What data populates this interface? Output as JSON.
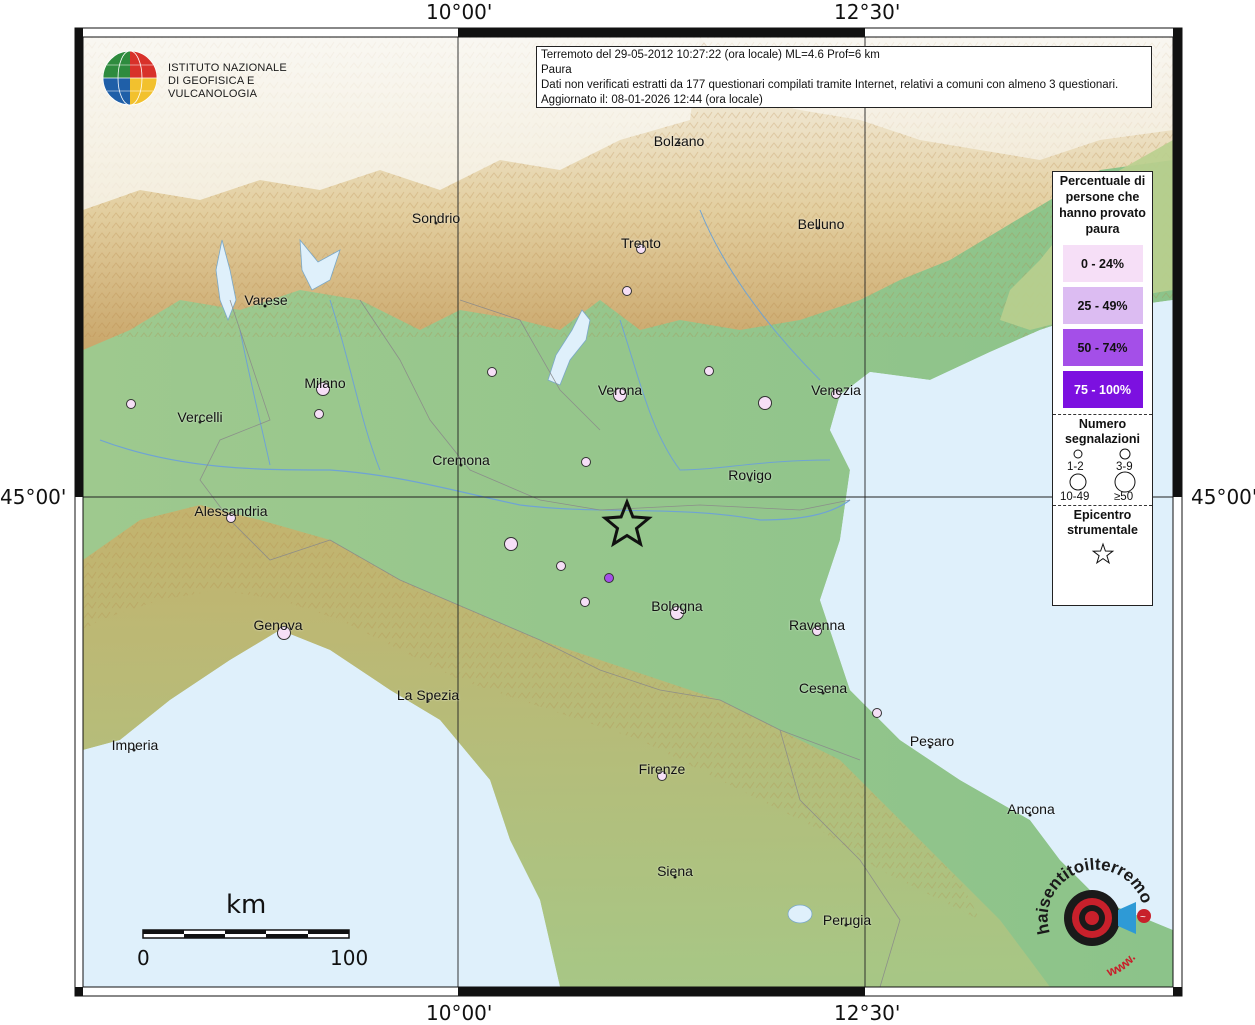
{
  "title_box": {
    "line1": "Terremoto del 29-05-2012 10:27:22 (ora locale) ML=4.6 Prof=6 km",
    "line2": "Paura",
    "line3": "Dati non verificati estratti da 177 questionari compilati tramite Internet, relativi a comuni con almeno 3 questionari.",
    "line4": "Aggiornato il: 08-01-2026 12:44 (ora locale)"
  },
  "logo": {
    "line1": "ISTITUTO NAZIONALE",
    "line2": "DI GEOFISICA E VULCANOLOGIA"
  },
  "axes": {
    "lon_top_1": "10°00'",
    "lon_top_2": "12°30'",
    "lon_bottom_1": "10°00'",
    "lon_bottom_2": "12°30'",
    "lat_left": "45°00'",
    "lat_right": "45°00'"
  },
  "cities": {
    "bolzano": "Bolzano",
    "sondrio": "Sondrio",
    "belluno": "Belluno",
    "trento": "Trento",
    "varese": "Varese",
    "milano": "Milano",
    "verona": "Verona",
    "venezia": "Venezia",
    "vercelli": "Vercelli",
    "cremona": "Cremona",
    "rovigo": "Rovigo",
    "alessandria": "Alessandria",
    "bologna": "Bologna",
    "genova": "Genova",
    "ravenna": "Ravenna",
    "cesena": "Cesena",
    "la_spezia": "La Spezia",
    "pesaro": "Pesaro",
    "imperia": "Imperia",
    "firenze": "Firenze",
    "ancona": "Ancona",
    "siena": "Siena",
    "perugia": "Perugia"
  },
  "legend": {
    "title": "Percentuale di persone che hanno provato paura",
    "bins": [
      {
        "label": "0 - 24%",
        "color": "#f6dff7"
      },
      {
        "label": "25 - 49%",
        "color": "#dcbcf2"
      },
      {
        "label": "50 - 74%",
        "color": "#a44fe8"
      },
      {
        "label": "75 - 100%",
        "color": "#7c10e0"
      }
    ],
    "count_title": "Numero segnalazioni",
    "count_labels": [
      "1-2",
      "3-9",
      "10-49",
      "≥50"
    ],
    "epicenter_title": "Epicentro strumentale"
  },
  "scale": {
    "unit": "km",
    "min": "0",
    "max": "100"
  },
  "branding": {
    "sentito": "haisentitoilterremoto.it",
    "www": "www."
  },
  "observations": [
    {
      "place": "Trento area",
      "bin": 0,
      "count": "1-2"
    },
    {
      "place": "Trento south",
      "bin": 0,
      "count": "1-2"
    },
    {
      "place": "Milano",
      "bin": 0,
      "count": "3-9"
    },
    {
      "place": "Milano south",
      "bin": 0,
      "count": "1-2"
    },
    {
      "place": "Varese west",
      "bin": 0,
      "count": "1-2"
    },
    {
      "place": "Brescia south",
      "bin": 0,
      "count": "1-2"
    },
    {
      "place": "Verona",
      "bin": 0,
      "count": "3-9"
    },
    {
      "place": "Vicenza",
      "bin": 0,
      "count": "1-2"
    },
    {
      "place": "Padova",
      "bin": 0,
      "count": "3-9"
    },
    {
      "place": "Venezia",
      "bin": 0,
      "count": "1-2"
    },
    {
      "place": "Mantova west",
      "bin": 0,
      "count": "1-2"
    },
    {
      "place": "Parma",
      "bin": 0,
      "count": "3-9"
    },
    {
      "place": "Reggio Emilia",
      "bin": 0,
      "count": "1-2"
    },
    {
      "place": "Modena",
      "bin": 2,
      "count": "1-2"
    },
    {
      "place": "Modena south",
      "bin": 0,
      "count": "1-2"
    },
    {
      "place": "Bologna",
      "bin": 0,
      "count": "3-9"
    },
    {
      "place": "Alessandria",
      "bin": 0,
      "count": "1-2"
    },
    {
      "place": "Genova",
      "bin": 0,
      "count": "3-9"
    },
    {
      "place": "Ravenna",
      "bin": 0,
      "count": "1-2"
    },
    {
      "place": "Pesaro north",
      "bin": 0,
      "count": "1-2"
    },
    {
      "place": "Firenze",
      "bin": 0,
      "count": "1-2"
    }
  ]
}
